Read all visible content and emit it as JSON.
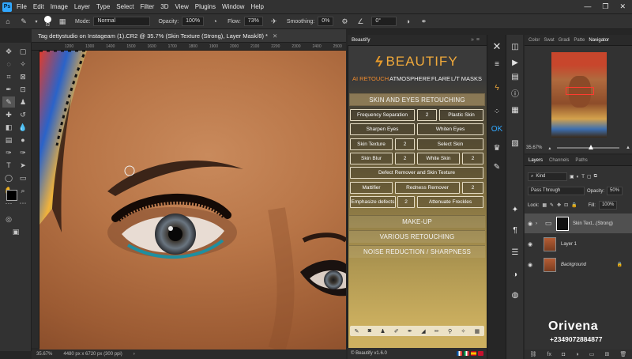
{
  "app": {
    "menu": [
      "File",
      "Edit",
      "Image",
      "Layer",
      "Type",
      "Select",
      "Filter",
      "3D",
      "View",
      "Plugins",
      "Window",
      "Help"
    ],
    "logo_text": "Ps"
  },
  "options_bar": {
    "brush_size": "52",
    "mode_label": "Mode:",
    "mode_value": "Normal",
    "opacity_label": "Opacity:",
    "opacity_value": "100%",
    "flow_label": "Flow:",
    "flow_value": "73%",
    "smoothing_label": "Smoothing:",
    "smoothing_value": "0%",
    "angle_value": "0°"
  },
  "document": {
    "tab_title": "Tag dettystudio on Instageam (1).CR2 @ 35.7% (Skin Texture (Strong), Layer Mask/8) *",
    "ruler_ticks": [
      "1200",
      "1300",
      "1400",
      "1500",
      "1600",
      "1700",
      "1800",
      "1900",
      "2000",
      "2100",
      "2200",
      "2300",
      "2400",
      "2500"
    ],
    "zoom": "35.67%",
    "dimensions": "4480 px x 6720 px (300 ppi)"
  },
  "beautify": {
    "panel_tab": "Beautify",
    "logo_word": "BEAUTIFY",
    "nav": [
      "AI RETOUCH",
      "ATMOSPHERE",
      "FLARE",
      "L/T MASKS"
    ],
    "section_main": "SKIN AND EYES RETOUCHING",
    "buttons": {
      "frequency_separation": "Frequency Separation",
      "freq_num": "2",
      "plastic_skin": "Plastic Skin",
      "sharpen_eyes": "Sharpen Eyes",
      "whiten_eyes": "Whiten Eyes",
      "skin_texture": "Skin Texture",
      "skin_texture_num": "2",
      "select_skin": "Select Skin",
      "skin_blur": "Skin Blur",
      "skin_blur_num": "2",
      "white_skin": "White Skin",
      "white_skin_num": "2",
      "defect_remover": "Defect Remover and Skin Texture",
      "mattifier": "Mattifier",
      "redness_remover": "Redness Remover",
      "redness_num": "2",
      "emphasize_defects": "Emphasize defects",
      "emphasize_num": "2",
      "attenuate_freckles": "Attenuate Freckles"
    },
    "sections": [
      "MAKE-UP",
      "VARIOUS RETOUCHING",
      "NOISE REDUCTION / SHARPNESS"
    ],
    "footer": "© Beautify v1.6.0"
  },
  "navigator": {
    "tabs": [
      "Color",
      "Swat",
      "Gradi",
      "Patte",
      "Navigator"
    ],
    "zoom": "35.67%"
  },
  "layers": {
    "tabs": [
      "Layers",
      "Channels",
      "Paths"
    ],
    "filter_kind": "Kind",
    "blend_mode": "Pass Through",
    "opacity_label": "Opacity:",
    "opacity_value": "50%",
    "lock_label": "Lock:",
    "fill_label": "Fill:",
    "fill_value": "100%",
    "items": [
      {
        "name": "Skin Text...(Strong)"
      },
      {
        "name": "Layer 1"
      },
      {
        "name": "Background"
      }
    ]
  },
  "watermark": {
    "name": "Orivena",
    "phone": "+2349072884877"
  },
  "colors": {
    "accent_orange": "#f08b2c",
    "ps_blue": "#31a8ff"
  }
}
